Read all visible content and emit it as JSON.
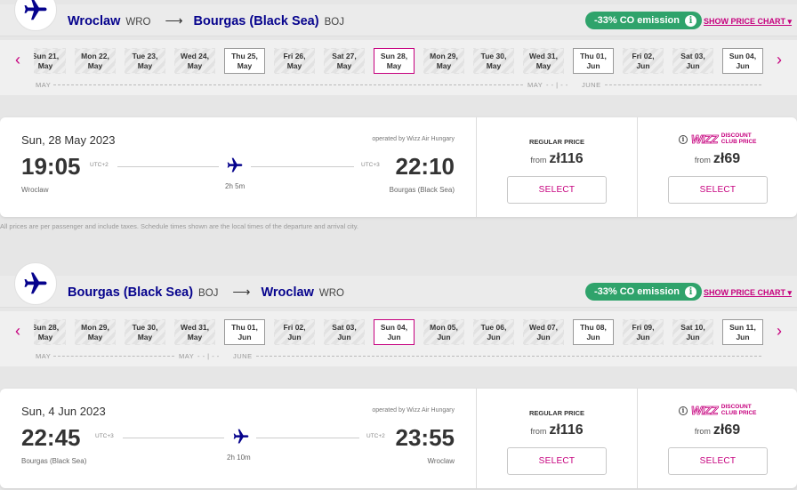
{
  "colors": {
    "brand": "#06038d",
    "accent": "#c6007e",
    "eco": "#2fa36b"
  },
  "flights": [
    {
      "route": {
        "from_city": "Wroclaw",
        "from_code": "WRO",
        "arrow": "⟶",
        "to_city": "Bourgas (Black Sea)",
        "to_code": "BOJ"
      },
      "co_emission": "-33% CO emission",
      "co_info": "i",
      "show_price_chart": "SHOW PRICE CHART ▾",
      "prev_arrow": "‹",
      "next_arrow": "›",
      "dates": [
        {
          "day": "Sun 21,",
          "month": "May",
          "style": "priced"
        },
        {
          "day": "Mon 22,",
          "month": "May",
          "style": "priced"
        },
        {
          "day": "Tue 23,",
          "month": "May",
          "style": "priced"
        },
        {
          "day": "Wed 24,",
          "month": "May",
          "style": "priced"
        },
        {
          "day": "Thu 25,",
          "month": "May",
          "style": "boxed"
        },
        {
          "day": "Fri 26,",
          "month": "May",
          "style": "priced"
        },
        {
          "day": "Sat 27,",
          "month": "May",
          "style": "priced"
        },
        {
          "day": "Sun 28,",
          "month": "May",
          "style": "selected"
        },
        {
          "day": "Mon 29,",
          "month": "May",
          "style": "priced"
        },
        {
          "day": "Tue 30,",
          "month": "May",
          "style": "priced"
        },
        {
          "day": "Wed 31,",
          "month": "May",
          "style": "priced"
        },
        {
          "day": "Thu 01,",
          "month": "Jun",
          "style": "boxed"
        },
        {
          "day": "Fri 02,",
          "month": "Jun",
          "style": "priced"
        },
        {
          "day": "Sat 03,",
          "month": "Jun",
          "style": "priced"
        },
        {
          "day": "Sun 04,",
          "month": "Jun",
          "style": "boxed"
        }
      ],
      "month_labels": {
        "start": "MAY",
        "mid": "MAY",
        "sep": "- - | - -",
        "end": "JUNE"
      },
      "card": {
        "date": "Sun, 28 May 2023",
        "operated_by": "operated by Wizz Air Hungary",
        "dep_time": "19:05",
        "dep_utc": "UTC+2",
        "dep_city": "Wroclaw",
        "arr_time": "22:10",
        "arr_utc": "UTC+3",
        "arr_city": "Bourgas (Black Sea)",
        "duration": "2h 5m",
        "regular_title": "REGULAR PRICE",
        "regular_from": "from",
        "regular_price": "zł116",
        "club_info": "i",
        "club_logo": "WIZZ",
        "club_line1": "DISCOUNT",
        "club_line2": "CLUB PRICE",
        "club_from": "from",
        "club_price": "zł69",
        "select_label": "SELECT"
      }
    },
    {
      "route": {
        "from_city": "Bourgas (Black Sea)",
        "from_code": "BOJ",
        "arrow": "⟶",
        "to_city": "Wroclaw",
        "to_code": "WRO"
      },
      "co_emission": "-33% CO emission",
      "co_info": "i",
      "show_price_chart": "SHOW PRICE CHART ▾",
      "prev_arrow": "‹",
      "next_arrow": "›",
      "dates": [
        {
          "day": "Sun 28,",
          "month": "May",
          "style": "priced"
        },
        {
          "day": "Mon 29,",
          "month": "May",
          "style": "priced"
        },
        {
          "day": "Tue 30,",
          "month": "May",
          "style": "priced"
        },
        {
          "day": "Wed 31,",
          "month": "May",
          "style": "priced"
        },
        {
          "day": "Thu 01,",
          "month": "Jun",
          "style": "boxed"
        },
        {
          "day": "Fri 02,",
          "month": "Jun",
          "style": "priced"
        },
        {
          "day": "Sat 03,",
          "month": "Jun",
          "style": "priced"
        },
        {
          "day": "Sun 04,",
          "month": "Jun",
          "style": "selected"
        },
        {
          "day": "Mon 05,",
          "month": "Jun",
          "style": "priced"
        },
        {
          "day": "Tue 06,",
          "month": "Jun",
          "style": "priced"
        },
        {
          "day": "Wed 07,",
          "month": "Jun",
          "style": "priced"
        },
        {
          "day": "Thu 08,",
          "month": "Jun",
          "style": "boxed"
        },
        {
          "day": "Fri 09,",
          "month": "Jun",
          "style": "priced"
        },
        {
          "day": "Sat 10,",
          "month": "Jun",
          "style": "priced"
        },
        {
          "day": "Sun 11,",
          "month": "Jun",
          "style": "boxed"
        }
      ],
      "month_labels": {
        "start": "MAY",
        "mid": "MAY",
        "sep": "- - | - -",
        "end": "JUNE"
      },
      "card": {
        "date": "Sun, 4 Jun 2023",
        "operated_by": "operated by Wizz Air Hungary",
        "dep_time": "22:45",
        "dep_utc": "UTC+3",
        "dep_city": "Bourgas (Black Sea)",
        "arr_time": "23:55",
        "arr_utc": "UTC+2",
        "arr_city": "Wroclaw",
        "duration": "2h 10m",
        "regular_title": "REGULAR PRICE",
        "regular_from": "from",
        "regular_price": "zł116",
        "club_info": "i",
        "club_logo": "WIZZ",
        "club_line1": "DISCOUNT",
        "club_line2": "CLUB PRICE",
        "club_from": "from",
        "club_price": "zł69",
        "select_label": "SELECT"
      }
    }
  ],
  "disclaimer": "All prices are per passenger and include taxes. Schedule times shown are the local times of the departure and arrival city."
}
